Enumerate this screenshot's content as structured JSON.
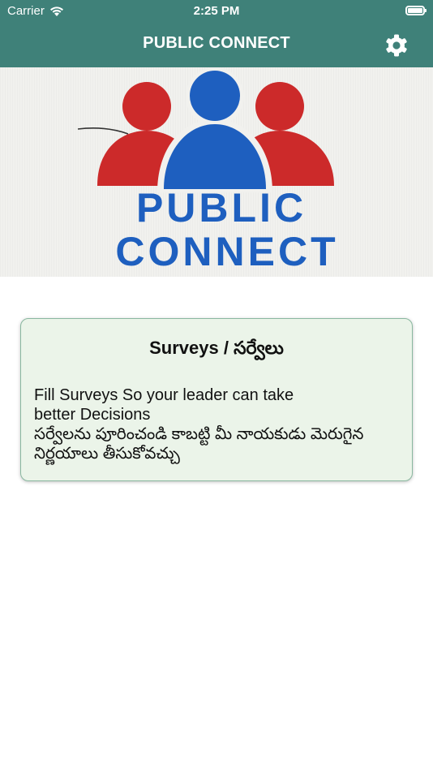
{
  "status_bar": {
    "carrier": "Carrier",
    "time": "2:25 PM"
  },
  "header": {
    "title": "PUBLIC CONNECT",
    "settings_icon": "gear-icon",
    "background": "#3f8179"
  },
  "banner": {
    "logo_line1": "PUBLIC",
    "logo_line2": "CONNECT",
    "colors": {
      "red": "#cc2a2a",
      "blue": "#1e5fbf"
    }
  },
  "survey_card": {
    "title": "Surveys / సర్వేలు",
    "description_en_line1": "Fill Surveys So your leader can take",
    "description_en_line2": "better Decisions",
    "description_te_line1": "సర్వేలను పూరించండి కాబట్టి మీ నాయకుడు మెరుగైన",
    "description_te_line2": "నిర్ణయాలు తీసుకోవచ్చు",
    "background": "#ebf4e9"
  }
}
